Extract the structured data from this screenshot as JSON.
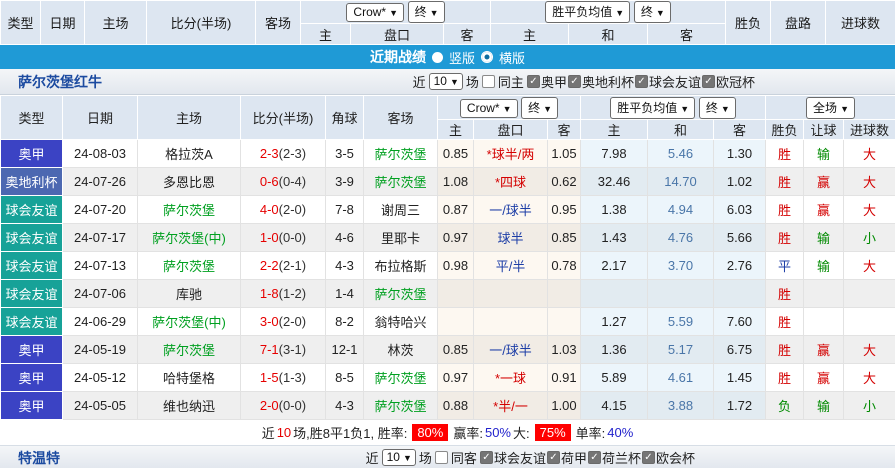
{
  "accent_colors": {
    "banner_blue": "#1f9ad6",
    "league_aojia": "#3b43c4",
    "league_aocup": "#4c68b1",
    "league_friendly": "#17a298",
    "win_red": "#d40000",
    "lose_green": "#008a00"
  },
  "top_header": {
    "cols": [
      "类型",
      "日期",
      "主场",
      "比分(半场)",
      "客场"
    ],
    "odds_group": {
      "select1": "Crow*",
      "select2": "终",
      "subcols": [
        "主",
        "盘口",
        "客"
      ]
    },
    "mean_group": {
      "select1": "胜平负均值",
      "select2": "终",
      "subcols": [
        "主",
        "和",
        "客"
      ]
    },
    "tail_cols": [
      "胜负",
      "盘路",
      "进球数"
    ]
  },
  "banner": {
    "title": "近期战绩",
    "option1": "竖版",
    "option2": "横版"
  },
  "team_section": {
    "team": "萨尔茨堡红牛",
    "near": "近",
    "count": "10",
    "games": "场",
    "same_label": "同主",
    "same_checked": false,
    "leagues": [
      "奥甲",
      "奥地利杯",
      "球会友谊",
      "欧冠杯"
    ]
  },
  "table": {
    "cols": [
      "类型",
      "日期",
      "主场",
      "比分(半场)",
      "角球",
      "客场"
    ],
    "odds_group": {
      "select1": "Crow*",
      "select2": "终",
      "subcols": [
        "主",
        "盘口",
        "客"
      ]
    },
    "mean_group": {
      "select1": "胜平负均值",
      "select2": "终",
      "subcols": [
        "主",
        "和",
        "客"
      ]
    },
    "tail_group": {
      "select1": "全场",
      "subcols": [
        "胜负",
        "让球",
        "进球数"
      ]
    },
    "rows": [
      {
        "type": "奥甲",
        "type_bg": "#3b43c4",
        "date": "24-08-03",
        "home": "格拉茨A",
        "home_green": false,
        "score": "2-3",
        "half": "(2-3)",
        "corners": "3-5",
        "away": "萨尔茨堡",
        "away_green": true,
        "o_home": "0.85",
        "handicap": "*球半/两",
        "handicap_color": "red",
        "o_away": "1.05",
        "m_home": "7.98",
        "m_draw": "5.46",
        "m_away": "1.30",
        "result": "胜",
        "result_color": "red",
        "handi_res": "输",
        "handi_res_color": "green",
        "goals": "大",
        "goals_color": "red"
      },
      {
        "type": "奥地利杯",
        "type_bg": "#4c68b1",
        "date": "24-07-26",
        "home": "多恩比恩",
        "home_green": false,
        "score": "0-6",
        "half": "(0-4)",
        "corners": "3-9",
        "away": "萨尔茨堡",
        "away_green": true,
        "o_home": "1.08",
        "handicap": "*四球",
        "handicap_color": "red",
        "o_away": "0.62",
        "m_home": "32.46",
        "m_draw": "14.70",
        "m_away": "1.02",
        "result": "胜",
        "result_color": "red",
        "handi_res": "赢",
        "handi_res_color": "red",
        "goals": "大",
        "goals_color": "red"
      },
      {
        "type": "球会友谊",
        "type_bg": "#17a298",
        "date": "24-07-20",
        "home": "萨尔茨堡",
        "home_green": true,
        "score": "4-0",
        "half": "(2-0)",
        "corners": "7-8",
        "away": "谢周三",
        "away_green": false,
        "o_home": "0.87",
        "handicap": "一/球半",
        "handicap_color": "navy",
        "o_away": "0.95",
        "m_home": "1.38",
        "m_draw": "4.94",
        "m_away": "6.03",
        "result": "胜",
        "result_color": "red",
        "handi_res": "赢",
        "handi_res_color": "red",
        "goals": "大",
        "goals_color": "red"
      },
      {
        "type": "球会友谊",
        "type_bg": "#17a298",
        "date": "24-07-17",
        "home": "萨尔茨堡(中)",
        "home_green": true,
        "score": "1-0",
        "half": "(0-0)",
        "corners": "4-6",
        "away": "里耶卡",
        "away_green": false,
        "o_home": "0.97",
        "handicap": "球半",
        "handicap_color": "navy",
        "o_away": "0.85",
        "m_home": "1.43",
        "m_draw": "4.76",
        "m_away": "5.66",
        "result": "胜",
        "result_color": "red",
        "handi_res": "输",
        "handi_res_color": "green",
        "goals": "小",
        "goals_color": "green"
      },
      {
        "type": "球会友谊",
        "type_bg": "#17a298",
        "date": "24-07-13",
        "home": "萨尔茨堡",
        "home_green": true,
        "score": "2-2",
        "half": "(2-1)",
        "corners": "4-3",
        "away": "布拉格斯",
        "away_green": false,
        "o_home": "0.98",
        "handicap": "平/半",
        "handicap_color": "navy",
        "o_away": "0.78",
        "m_home": "2.17",
        "m_draw": "3.70",
        "m_away": "2.76",
        "result": "平",
        "result_color": "navy",
        "handi_res": "输",
        "handi_res_color": "green",
        "goals": "大",
        "goals_color": "red"
      },
      {
        "type": "球会友谊",
        "type_bg": "#17a298",
        "date": "24-07-06",
        "home": "库驰",
        "home_green": false,
        "score": "1-8",
        "half": "(1-2)",
        "corners": "1-4",
        "away": "萨尔茨堡",
        "away_green": true,
        "o_home": "",
        "handicap": "",
        "handicap_color": "navy",
        "o_away": "",
        "m_home": "",
        "m_draw": "",
        "m_away": "",
        "result": "胜",
        "result_color": "red",
        "handi_res": "",
        "handi_res_color": "green",
        "goals": "",
        "goals_color": "red"
      },
      {
        "type": "球会友谊",
        "type_bg": "#17a298",
        "date": "24-06-29",
        "home": "萨尔茨堡(中)",
        "home_green": true,
        "score": "3-0",
        "half": "(2-0)",
        "corners": "8-2",
        "away": "翁特哈兴",
        "away_green": false,
        "o_home": "",
        "handicap": "",
        "handicap_color": "navy",
        "o_away": "",
        "m_home": "1.27",
        "m_draw": "5.59",
        "m_away": "7.60",
        "result": "胜",
        "result_color": "red",
        "handi_res": "",
        "handi_res_color": "green",
        "goals": "",
        "goals_color": "red"
      },
      {
        "type": "奥甲",
        "type_bg": "#3b43c4",
        "date": "24-05-19",
        "home": "萨尔茨堡",
        "home_green": true,
        "score": "7-1",
        "half": "(3-1)",
        "corners": "12-1",
        "away": "林茨",
        "away_green": false,
        "o_home": "0.85",
        "handicap": "一/球半",
        "handicap_color": "navy",
        "o_away": "1.03",
        "m_home": "1.36",
        "m_draw": "5.17",
        "m_away": "6.75",
        "result": "胜",
        "result_color": "red",
        "handi_res": "赢",
        "handi_res_color": "red",
        "goals": "大",
        "goals_color": "red"
      },
      {
        "type": "奥甲",
        "type_bg": "#3b43c4",
        "date": "24-05-12",
        "home": "哈特堡格",
        "home_green": false,
        "score": "1-5",
        "half": "(1-3)",
        "corners": "8-5",
        "away": "萨尔茨堡",
        "away_green": true,
        "o_home": "0.97",
        "handicap": "*一球",
        "handicap_color": "red",
        "o_away": "0.91",
        "m_home": "5.89",
        "m_draw": "4.61",
        "m_away": "1.45",
        "result": "胜",
        "result_color": "red",
        "handi_res": "赢",
        "handi_res_color": "red",
        "goals": "大",
        "goals_color": "red"
      },
      {
        "type": "奥甲",
        "type_bg": "#3b43c4",
        "date": "24-05-05",
        "home": "维也纳迅",
        "home_green": false,
        "score": "2-0",
        "half": "(0-0)",
        "corners": "4-3",
        "away": "萨尔茨堡",
        "away_green": true,
        "o_home": "0.88",
        "handicap": "*半/一",
        "handicap_color": "red",
        "o_away": "1.00",
        "m_home": "4.15",
        "m_draw": "3.88",
        "m_away": "1.72",
        "result": "负",
        "result_color": "green",
        "handi_res": "输",
        "handi_res_color": "green",
        "goals": "小",
        "goals_color": "green"
      }
    ]
  },
  "footer": {
    "near": "近",
    "count": "10",
    "text1": "场,胜8平1负1, 胜率:",
    "rate1": "80%",
    "text2": "赢率:",
    "rate2": "50%",
    "text3": "大:",
    "rate3": "75%",
    "text4": "单率:",
    "rate4": "40%"
  },
  "bottom": {
    "team": "特温特",
    "near": "近",
    "count": "10",
    "games": "场",
    "same_label": "同客",
    "same_checked": false,
    "leagues": [
      "球会友谊",
      "荷甲",
      "荷兰杯",
      "欧会杯"
    ]
  }
}
